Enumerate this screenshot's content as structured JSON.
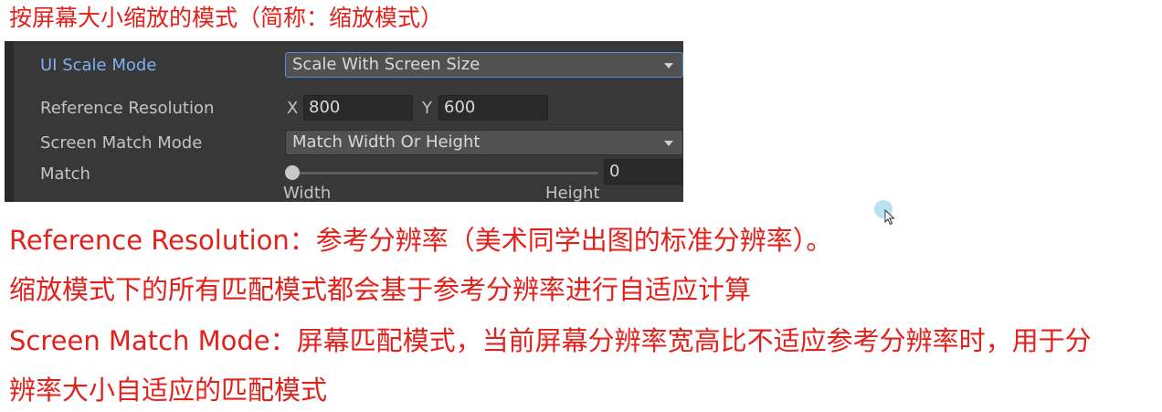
{
  "notes": {
    "title": "按屏幕大小缩放的模式（简称：缩放模式）",
    "line1": "Reference Resolution：参考分辨率（美术同学出图的标准分辨率）。",
    "line2": "缩放模式下的所有匹配模式都会基于参考分辨率进行自适应计算",
    "line3": "Screen Match Mode：屏幕匹配模式，当前屏幕分辨率宽高比不适应参考分辨率时，用于分",
    "line4": "辨率大小自适应的匹配模式"
  },
  "inspector": {
    "ui_scale_mode": {
      "label": "UI Scale Mode",
      "value": "Scale With Screen Size"
    },
    "reference_resolution": {
      "label": "Reference Resolution",
      "x_label": "X",
      "x_value": "800",
      "y_label": "Y",
      "y_value": "600"
    },
    "screen_match_mode": {
      "label": "Screen Match Mode",
      "value": "Match Width Or Height"
    },
    "match": {
      "label": "Match",
      "value": "0",
      "level": 0,
      "min_label": "Width",
      "max_label": "Height"
    }
  },
  "colors": {
    "note_text": "#e3211b",
    "panel_bg": "#383838",
    "active_label": "#7fb0f0",
    "focus_border": "#4c8fe0"
  },
  "icons": {
    "dropdown": "chevron-down-icon",
    "cursor": "mouse-pointer-icon"
  }
}
